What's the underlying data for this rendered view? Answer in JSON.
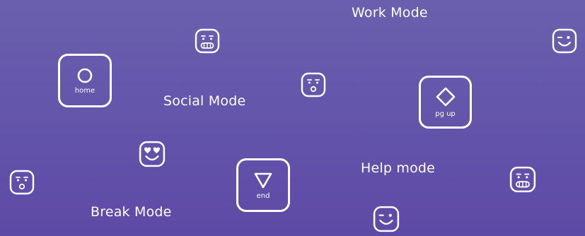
{
  "modes": {
    "work": "Work Mode",
    "social": "Social Mode",
    "help": "Help mode",
    "break": "Break Mode"
  },
  "keys": {
    "home": {
      "label": "home",
      "icon": "circle-icon"
    },
    "pgup": {
      "label": "pg up",
      "icon": "diamond-icon"
    },
    "end": {
      "label": "end",
      "icon": "triangle-down-icon"
    }
  },
  "emojis": [
    "grimace-face-icon",
    "wink-face-icon",
    "surprised-face-icon",
    "heart-eyes-face-icon",
    "surprised-face-icon",
    "grimace-face-icon",
    "wink-face-icon"
  ],
  "colors": {
    "background_top": "#6a5fae",
    "background_bottom": "#5d4aa6",
    "foreground": "#ffffff"
  }
}
